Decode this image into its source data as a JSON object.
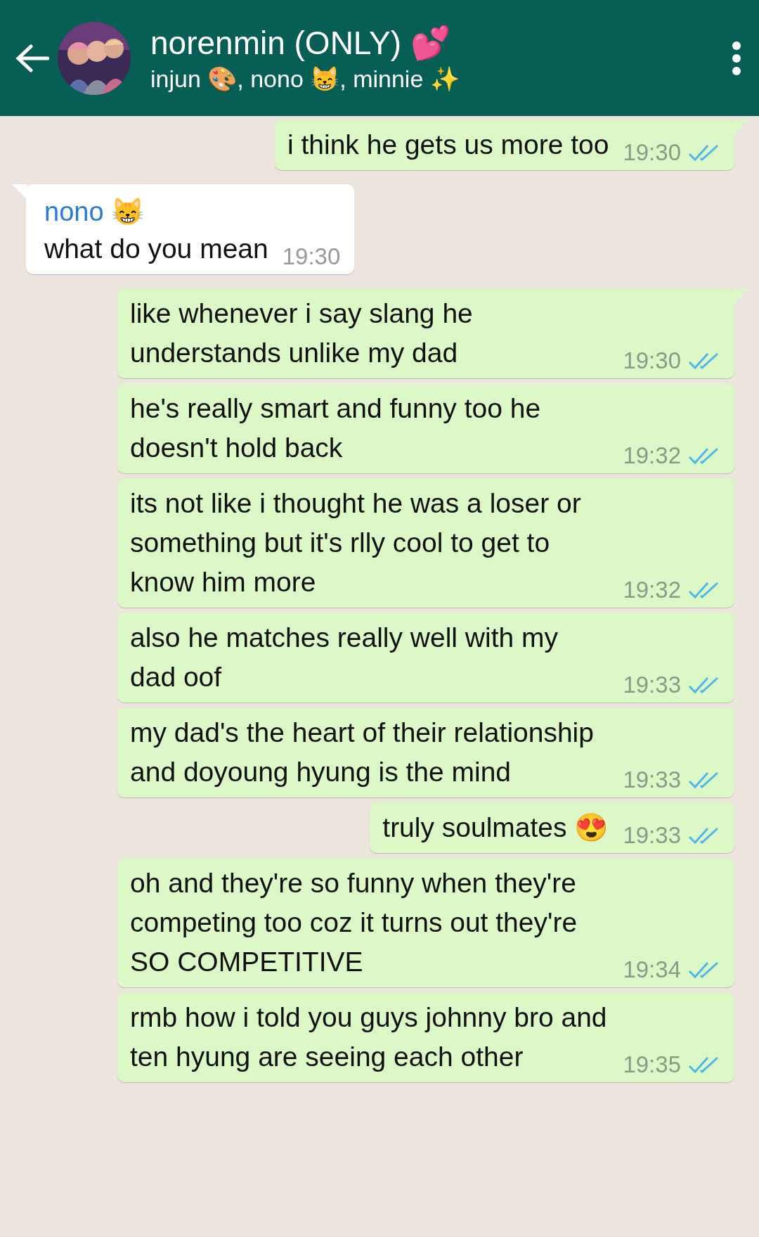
{
  "header": {
    "title": "norenmin (ONLY) 💕",
    "subtitle": "injun 🎨, nono 😸, minnie ✨"
  },
  "messages": [
    {
      "kind": "outgoing",
      "tail": true,
      "text": "i think he gets us more too",
      "time": "19:30",
      "read": true
    },
    {
      "kind": "incoming",
      "tail": true,
      "sender": "nono 😸",
      "text": "what do you mean",
      "time": "19:30"
    },
    {
      "kind": "outgoing",
      "tail": true,
      "text": "like whenever i say slang he understands unlike my dad",
      "time": "19:30",
      "read": true
    },
    {
      "kind": "outgoing",
      "tail": false,
      "text": "he's really smart and funny too he doesn't hold back",
      "time": "19:32",
      "read": true
    },
    {
      "kind": "outgoing",
      "tail": false,
      "text": "its not like i thought he was a loser or something but it's rlly cool to get to know him more",
      "time": "19:32",
      "read": true
    },
    {
      "kind": "outgoing",
      "tail": false,
      "text": "also he matches really well with my dad oof",
      "time": "19:33",
      "read": true
    },
    {
      "kind": "outgoing",
      "tail": false,
      "text": "my dad's the heart of their relationship and doyoung hyung is the mind",
      "time": "19:33",
      "read": true
    },
    {
      "kind": "outgoing",
      "tail": false,
      "text": "truly soulmates 😍",
      "time": "19:33",
      "read": true
    },
    {
      "kind": "outgoing",
      "tail": false,
      "text": "oh and they're so funny when they're competing too coz it turns out they're SO COMPETITIVE",
      "time": "19:34",
      "read": true
    },
    {
      "kind": "outgoing",
      "tail": false,
      "text": "rmb how i told you guys johnny bro and ten hyung are seeing each other",
      "time": "19:35",
      "read": true
    }
  ]
}
